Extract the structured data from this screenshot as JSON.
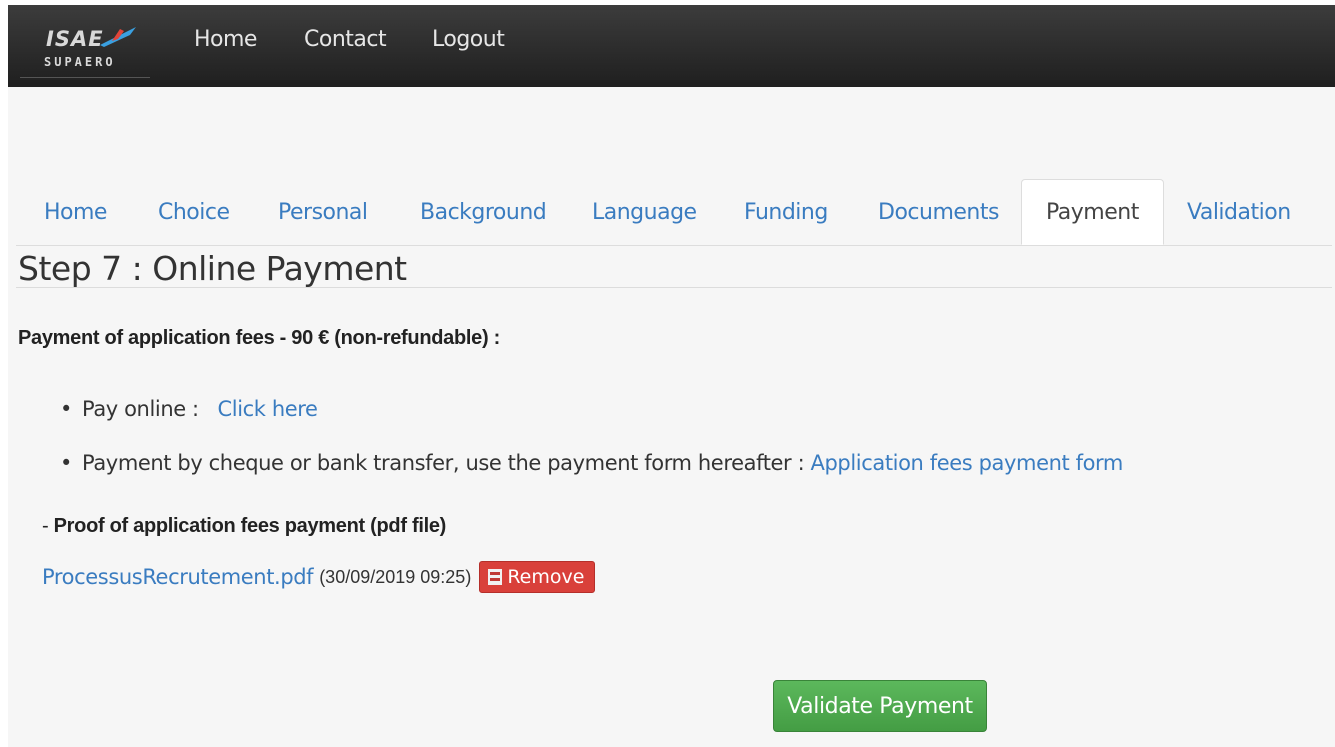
{
  "brand": {
    "line1": "ISAE",
    "line2": "SUPAERO"
  },
  "navbar": {
    "links": [
      {
        "label": "Home"
      },
      {
        "label": "Contact"
      },
      {
        "label": "Logout"
      }
    ]
  },
  "tabs": [
    {
      "label": "Home"
    },
    {
      "label": "Choice"
    },
    {
      "label": "Personal"
    },
    {
      "label": "Background"
    },
    {
      "label": "Language"
    },
    {
      "label": "Funding"
    },
    {
      "label": "Documents"
    },
    {
      "label": "Payment",
      "active": true
    },
    {
      "label": "Validation"
    }
  ],
  "page": {
    "title": "Step 7 : Online Payment",
    "section_heading": "Payment of application fees - 90 € (non-refundable) :",
    "bullets": {
      "pay_online_label": "Pay online :",
      "pay_online_link": "Click here",
      "cheque_label": "Payment by cheque or bank transfer, use the payment form hereafter :",
      "cheque_link": "Application fees payment form"
    },
    "proof": {
      "prefix": "- ",
      "label": "Proof of application fees payment (pdf file)",
      "filename": "ProcessusRecrutement.pdf",
      "date": "(30/09/2019 09:25)",
      "remove_label": "Remove"
    },
    "validate_label": "Validate Payment"
  },
  "colors": {
    "link": "#3a7cc0",
    "danger": "#d9403a",
    "success": "#5cb85c",
    "navbar": "#2a2a2a"
  }
}
